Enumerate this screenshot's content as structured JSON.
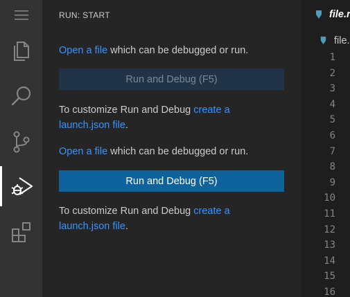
{
  "sidebar": {
    "title": "RUN: START",
    "sections": [
      {
        "open_link": "Open a file",
        "open_text": " which can be debugged or run.",
        "button_label": "Run and Debug (F5)",
        "button_state": "disabled",
        "customize_text": "To customize Run and Debug ",
        "customize_link": "create a launch.json file",
        "customize_end": "."
      },
      {
        "open_link": "Open a file",
        "open_text": " which can be debugged or run.",
        "button_label": "Run and Debug (F5)",
        "button_state": "primary",
        "customize_text": "To customize Run and Debug ",
        "customize_link": "create a launch.json file",
        "customize_end": "."
      }
    ]
  },
  "activity_bar": {
    "items": [
      {
        "name": "menu",
        "icon": "hamburger-icon"
      },
      {
        "name": "explorer",
        "icon": "files-icon"
      },
      {
        "name": "search",
        "icon": "search-icon"
      },
      {
        "name": "source-control",
        "icon": "source-control-icon"
      },
      {
        "name": "run-debug",
        "icon": "run-debug-icon",
        "active": true
      },
      {
        "name": "extensions",
        "icon": "extensions-icon"
      }
    ]
  },
  "editor": {
    "tab_label": "file.r",
    "breadcrumb_label": "file.",
    "line_numbers": [
      "1",
      "2",
      "3",
      "4",
      "5",
      "6",
      "7",
      "8",
      "9",
      "10",
      "11",
      "12",
      "13",
      "14",
      "15",
      "16"
    ]
  },
  "colors": {
    "link": "#3794ff",
    "button_primary": "#0e639c",
    "button_disabled": "#213347",
    "file_icon": "#519aba"
  }
}
